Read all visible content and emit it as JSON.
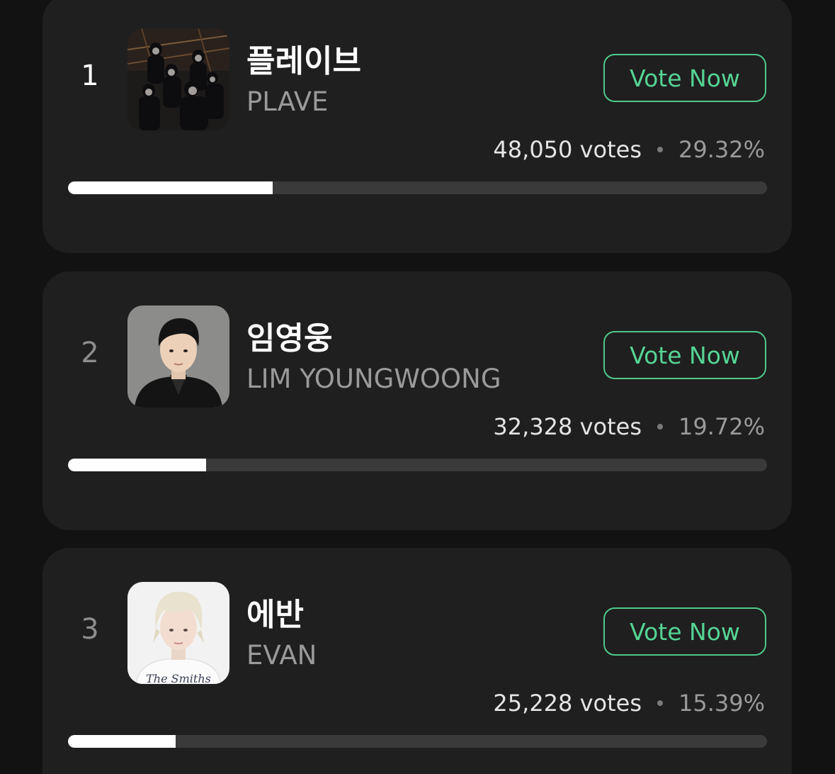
{
  "entries": [
    {
      "rank": "1",
      "name_ko": "플레이브",
      "name_en": "PLAVE",
      "vote_label": "Vote Now",
      "votes": "48,050 votes",
      "percent": "29.32%",
      "progress": 0.2932,
      "image": "group-photo"
    },
    {
      "rank": "2",
      "name_ko": "임영웅",
      "name_en": "LIM YOUNGWOONG",
      "vote_label": "Vote Now",
      "votes": "32,328 votes",
      "percent": "19.72%",
      "progress": 0.1972,
      "image": "portrait-photo"
    },
    {
      "rank": "3",
      "name_ko": "에반",
      "name_en": "EVAN",
      "vote_label": "Vote Now",
      "votes": "25,228 votes",
      "percent": "15.39%",
      "progress": 0.1539,
      "image": "portrait-photo",
      "shirt_text": "The Smiths"
    }
  ],
  "colors": {
    "background": "#121212",
    "card": "#1f1f1f",
    "accent": "#4fc98a",
    "bar_track": "#3a3a3a",
    "bar_fill": "#ffffff"
  }
}
